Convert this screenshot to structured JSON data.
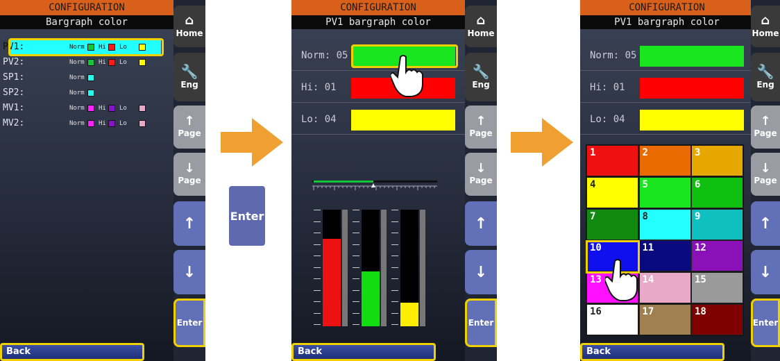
{
  "header": {
    "title": "CONFIGURATION"
  },
  "panel1": {
    "subtitle": "Bargraph color",
    "rows": [
      {
        "label": "PV1:",
        "norm": "#12c83a",
        "hi": "#ff1a1a",
        "lo": "#ffff00",
        "has_hi": true
      },
      {
        "label": "PV2:",
        "norm": "#12c83a",
        "hi": "#ff1a1a",
        "lo": "#ffff00",
        "has_hi": true
      },
      {
        "label": "SP1:",
        "norm": "#22ffee",
        "has_hi": false
      },
      {
        "label": "SP2:",
        "norm": "#22ffee",
        "has_hi": false
      },
      {
        "label": "MV1:",
        "norm": "#ff22ff",
        "hi": "#8a12c8",
        "lo": "#e8a8c8",
        "has_hi": true
      },
      {
        "label": "MV2:",
        "norm": "#ff22ff",
        "hi": "#8a12c8",
        "lo": "#e8a8c8",
        "has_hi": true
      }
    ],
    "norm_text": "Norm",
    "hi_text": "Hi",
    "lo_text": "Lo"
  },
  "panel2": {
    "subtitle": "PV1 bargraph color",
    "fields": [
      {
        "label": "Norm:",
        "value": "05",
        "color": "#19e61e"
      },
      {
        "label": "Hi:",
        "value": "01",
        "color": "#ff0000"
      },
      {
        "label": "Lo:",
        "value": "04",
        "color": "#ffff00"
      }
    ],
    "bars": [
      {
        "level": 0.75,
        "color": "#ee1111"
      },
      {
        "level": 0.47,
        "color": "#11dd11"
      },
      {
        "level": 0.2,
        "color": "#ffee00"
      }
    ]
  },
  "panel3": {
    "subtitle": "PV1 bargraph color",
    "palette": [
      {
        "n": "1",
        "color": "#ee1111"
      },
      {
        "n": "2",
        "color": "#e86a00"
      },
      {
        "n": "3",
        "color": "#e6a800"
      },
      {
        "n": "4",
        "color": "#ffff00"
      },
      {
        "n": "5",
        "color": "#19e61e"
      },
      {
        "n": "6",
        "color": "#10c010"
      },
      {
        "n": "7",
        "color": "#118a11"
      },
      {
        "n": "8",
        "color": "#22ffff"
      },
      {
        "n": "9",
        "color": "#10c0c0"
      },
      {
        "n": "10",
        "color": "#1010ee"
      },
      {
        "n": "11",
        "color": "#0a0a80"
      },
      {
        "n": "12",
        "color": "#8a10b8"
      },
      {
        "n": "13",
        "color": "#ff10ff"
      },
      {
        "n": "14",
        "color": "#e8a8c8"
      },
      {
        "n": "15",
        "color": "#9a9a9a"
      },
      {
        "n": "16",
        "color": "#ffffff"
      },
      {
        "n": "17",
        "color": "#a08050"
      },
      {
        "n": "18",
        "color": "#800000"
      }
    ]
  },
  "sidebar": {
    "home": "Home",
    "eng": "Eng",
    "page": "Page",
    "enter": "Enter",
    "home_icon": "home-icon",
    "eng_icon": "wrench-icon"
  },
  "footer": {
    "back": "Back"
  },
  "middle_button": {
    "label": "Enter"
  },
  "arrow_color": "#f0a030"
}
